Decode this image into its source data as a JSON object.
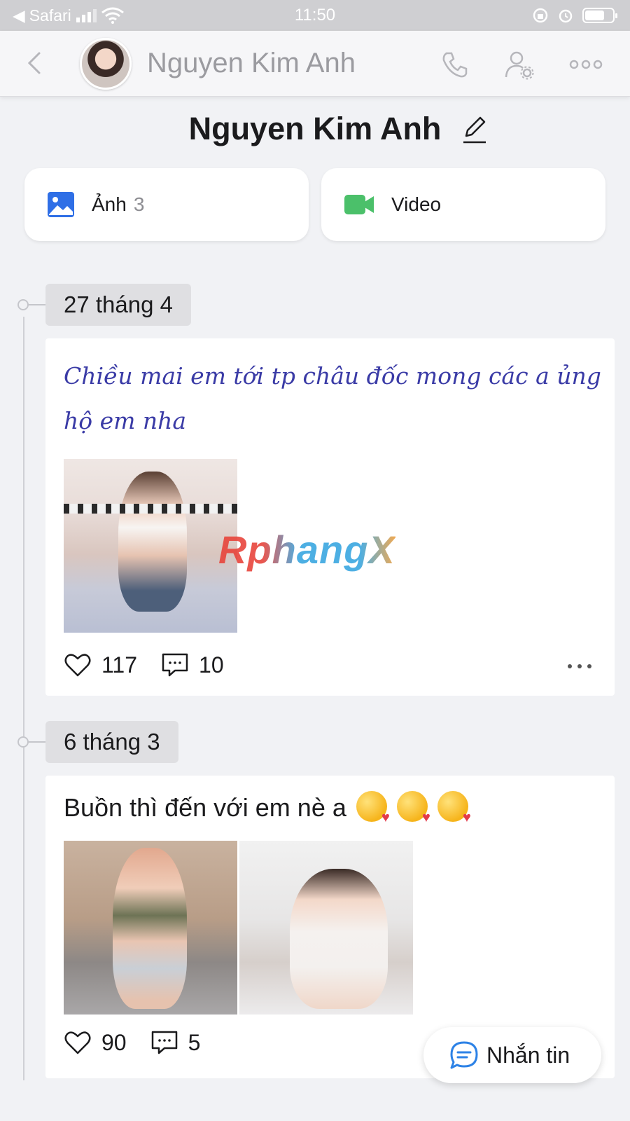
{
  "status_bar": {
    "back_app": "Safari",
    "time": "11:50"
  },
  "header": {
    "name": "Nguyen Kim Anh"
  },
  "profile": {
    "name": "Nguyen Kim Anh"
  },
  "media": {
    "photos_label": "Ảnh",
    "photos_count": "3",
    "video_label": "Video"
  },
  "watermark": "RphangX",
  "posts": [
    {
      "date": "27 tháng 4",
      "text": "Chiều mai em tới tp châu đốc mong các a ủng hộ em nha",
      "likes": "117",
      "comments": "10"
    },
    {
      "date": "6 tháng 3",
      "text": "Buồn thì đến với em nè a",
      "likes": "90",
      "comments": "5"
    }
  ],
  "chat_button": {
    "label": "Nhắn tin"
  },
  "icons": {
    "back": "chevron-left-icon",
    "call": "phone-icon",
    "settings": "user-settings-icon",
    "more": "more-icon",
    "edit": "pencil-icon",
    "photo": "image-icon",
    "video": "video-camera-icon",
    "like": "heart-icon",
    "comment": "comment-icon",
    "chat": "chat-bubble-icon"
  },
  "colors": {
    "photo_icon": "#2f6fe6",
    "video_icon": "#4bc06a",
    "chat_icon": "#2d82e6",
    "script_text": "#3a3ba6"
  }
}
